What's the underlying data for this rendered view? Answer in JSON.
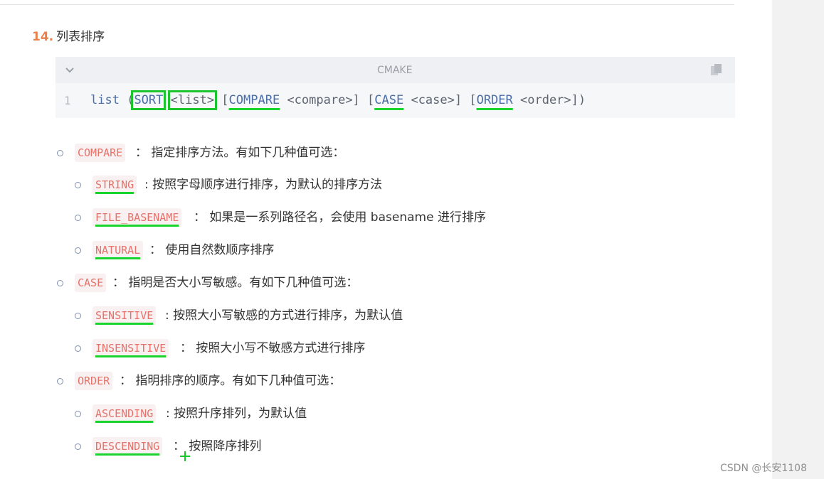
{
  "heading": {
    "number": "14.",
    "title": "列表排序"
  },
  "code_block": {
    "language": "CMAKE",
    "line_number": "1",
    "tokens": {
      "cmd": "list",
      "open": " (",
      "sort": "SORT",
      "sp1": " ",
      "list_arg": "<list>",
      "opt1_open": " [",
      "compare_kw": "COMPARE",
      "compare_arg": " <compare>] [",
      "case_kw": "CASE",
      "case_arg": " <case>] [",
      "order_kw": "ORDER",
      "order_arg": " <order>])"
    }
  },
  "items": [
    {
      "tag": "COMPARE",
      "text": "： 指定排序方法。有如下几种值可选："
    },
    {
      "tag": "STRING",
      "text": ": 按照字母顺序进行排序，为默认的排序方法"
    },
    {
      "tag": "FILE_BASENAME",
      "text": "： 如果是一系列路径名，会使用 basename 进行排序"
    },
    {
      "tag": "NATURAL",
      "text": "： 使用自然数顺序排序"
    },
    {
      "tag": "CASE",
      "text": "： 指明是否大小写敏感。有如下几种值可选："
    },
    {
      "tag": "SENSITIVE",
      "text": ": 按照大小写敏感的方式进行排序，为默认值"
    },
    {
      "tag": "INSENSITIVE",
      "text": "： 按照大小写不敏感方式进行排序"
    },
    {
      "tag": "ORDER",
      "text": "： 指明排序的顺序。有如下几种值可选："
    },
    {
      "tag": "ASCENDING",
      "text": ": 按照升序排列，为默认值"
    },
    {
      "tag": "DESCENDING",
      "text": "： 按照降序排列"
    }
  ],
  "watermark": "CSDN @长安1108",
  "icons": {
    "collapse": "chevron-down-icon",
    "copy": "copy-icon",
    "bullet": "hollow-circle-bullet"
  },
  "colors": {
    "tag_text": "#e6736b",
    "tag_bg": "#f9f1f1",
    "heading_num": "#e6824a",
    "annotation_green": "#1bc52c"
  }
}
